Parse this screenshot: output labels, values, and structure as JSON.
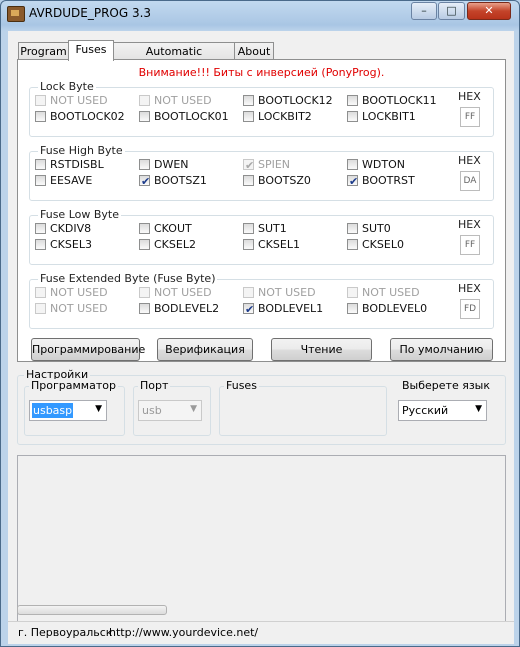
{
  "window": {
    "title": "AVRDUDE_PROG 3.3",
    "minimize": "–",
    "maximize": "□",
    "close": "✕"
  },
  "tabs": [
    "Program",
    "Fuses",
    "Automatic programming",
    "About"
  ],
  "fuses": {
    "warning": "Внимание!!! Биты с инверсией (PonyProg).",
    "hex_label": "HEX",
    "lock_byte": {
      "title": "Lock Byte",
      "bits": [
        {
          "label": "NOT USED",
          "checked": false,
          "enabled": false
        },
        {
          "label": "NOT USED",
          "checked": false,
          "enabled": false
        },
        {
          "label": "BOOTLOCK12",
          "checked": false,
          "enabled": true
        },
        {
          "label": "BOOTLOCK11",
          "checked": false,
          "enabled": true
        },
        {
          "label": "BOOTLOCK02",
          "checked": false,
          "enabled": true
        },
        {
          "label": "BOOTLOCK01",
          "checked": false,
          "enabled": true
        },
        {
          "label": "LOCKBIT2",
          "checked": false,
          "enabled": true
        },
        {
          "label": "LOCKBIT1",
          "checked": false,
          "enabled": true
        }
      ],
      "hex": "FF"
    },
    "high_byte": {
      "title": "Fuse High Byte",
      "bits": [
        {
          "label": "RSTDISBL",
          "checked": false,
          "enabled": true
        },
        {
          "label": "DWEN",
          "checked": false,
          "enabled": true
        },
        {
          "label": "SPIEN",
          "checked": true,
          "enabled": false
        },
        {
          "label": "WDTON",
          "checked": false,
          "enabled": true
        },
        {
          "label": "EESAVE",
          "checked": false,
          "enabled": true
        },
        {
          "label": "BOOTSZ1",
          "checked": true,
          "enabled": true
        },
        {
          "label": "BOOTSZ0",
          "checked": false,
          "enabled": true
        },
        {
          "label": "BOOTRST",
          "checked": true,
          "enabled": true
        }
      ],
      "hex": "DA"
    },
    "low_byte": {
      "title": "Fuse Low Byte",
      "bits": [
        {
          "label": "CKDIV8",
          "checked": false,
          "enabled": true
        },
        {
          "label": "CKOUT",
          "checked": false,
          "enabled": true
        },
        {
          "label": "SUT1",
          "checked": false,
          "enabled": true
        },
        {
          "label": "SUT0",
          "checked": false,
          "enabled": true
        },
        {
          "label": "CKSEL3",
          "checked": false,
          "enabled": true
        },
        {
          "label": "CKSEL2",
          "checked": false,
          "enabled": true
        },
        {
          "label": "CKSEL1",
          "checked": false,
          "enabled": true
        },
        {
          "label": "CKSEL0",
          "checked": false,
          "enabled": true
        }
      ],
      "hex": "FF"
    },
    "ext_byte": {
      "title": "Fuse Extended Byte (Fuse Byte)",
      "bits": [
        {
          "label": "NOT USED",
          "checked": false,
          "enabled": false
        },
        {
          "label": "NOT USED",
          "checked": false,
          "enabled": false
        },
        {
          "label": "NOT USED",
          "checked": false,
          "enabled": false
        },
        {
          "label": "NOT USED",
          "checked": false,
          "enabled": false
        },
        {
          "label": "NOT USED",
          "checked": false,
          "enabled": false
        },
        {
          "label": "BODLEVEL2",
          "checked": false,
          "enabled": true
        },
        {
          "label": "BODLEVEL1",
          "checked": true,
          "enabled": true
        },
        {
          "label": "BODLEVEL0",
          "checked": false,
          "enabled": true
        }
      ],
      "hex": "FD"
    },
    "buttons": {
      "program": "Программирование",
      "verify": "Верификация",
      "read": "Чтение",
      "default": "По умолчанию"
    }
  },
  "settings": {
    "title": "Настройки",
    "programmer": {
      "label": "Программатор",
      "value": "usbasp"
    },
    "port": {
      "label": "Порт",
      "value": "usb"
    },
    "fuses_label": "Fuses",
    "language": {
      "label": "Выберете язык",
      "value": "Русский"
    }
  },
  "status": {
    "city": "г. Первоуральск",
    "url": "http://www.yourdevice.net/"
  }
}
